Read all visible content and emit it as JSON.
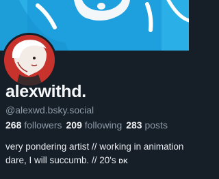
{
  "profile": {
    "display_name": "alexwithd.",
    "handle": "@alexwd.bsky.social",
    "bio_line1": "very pondering artist // working in animation",
    "bio_line2": "dare, I will succumb. // 20's",
    "bio_tag": "DK"
  },
  "stats": {
    "followers_count": "268",
    "followers_label": "followers",
    "following_count": "209",
    "following_label": "following",
    "posts_count": "283",
    "posts_label": "posts"
  },
  "colors": {
    "background": "#161e27",
    "banner": "#1ea0de",
    "muted_text": "#8d9aa8",
    "avatar_bg": "#c8322c"
  },
  "icons": {
    "banner": "profile-banner-image",
    "avatar": "user-avatar-image"
  }
}
